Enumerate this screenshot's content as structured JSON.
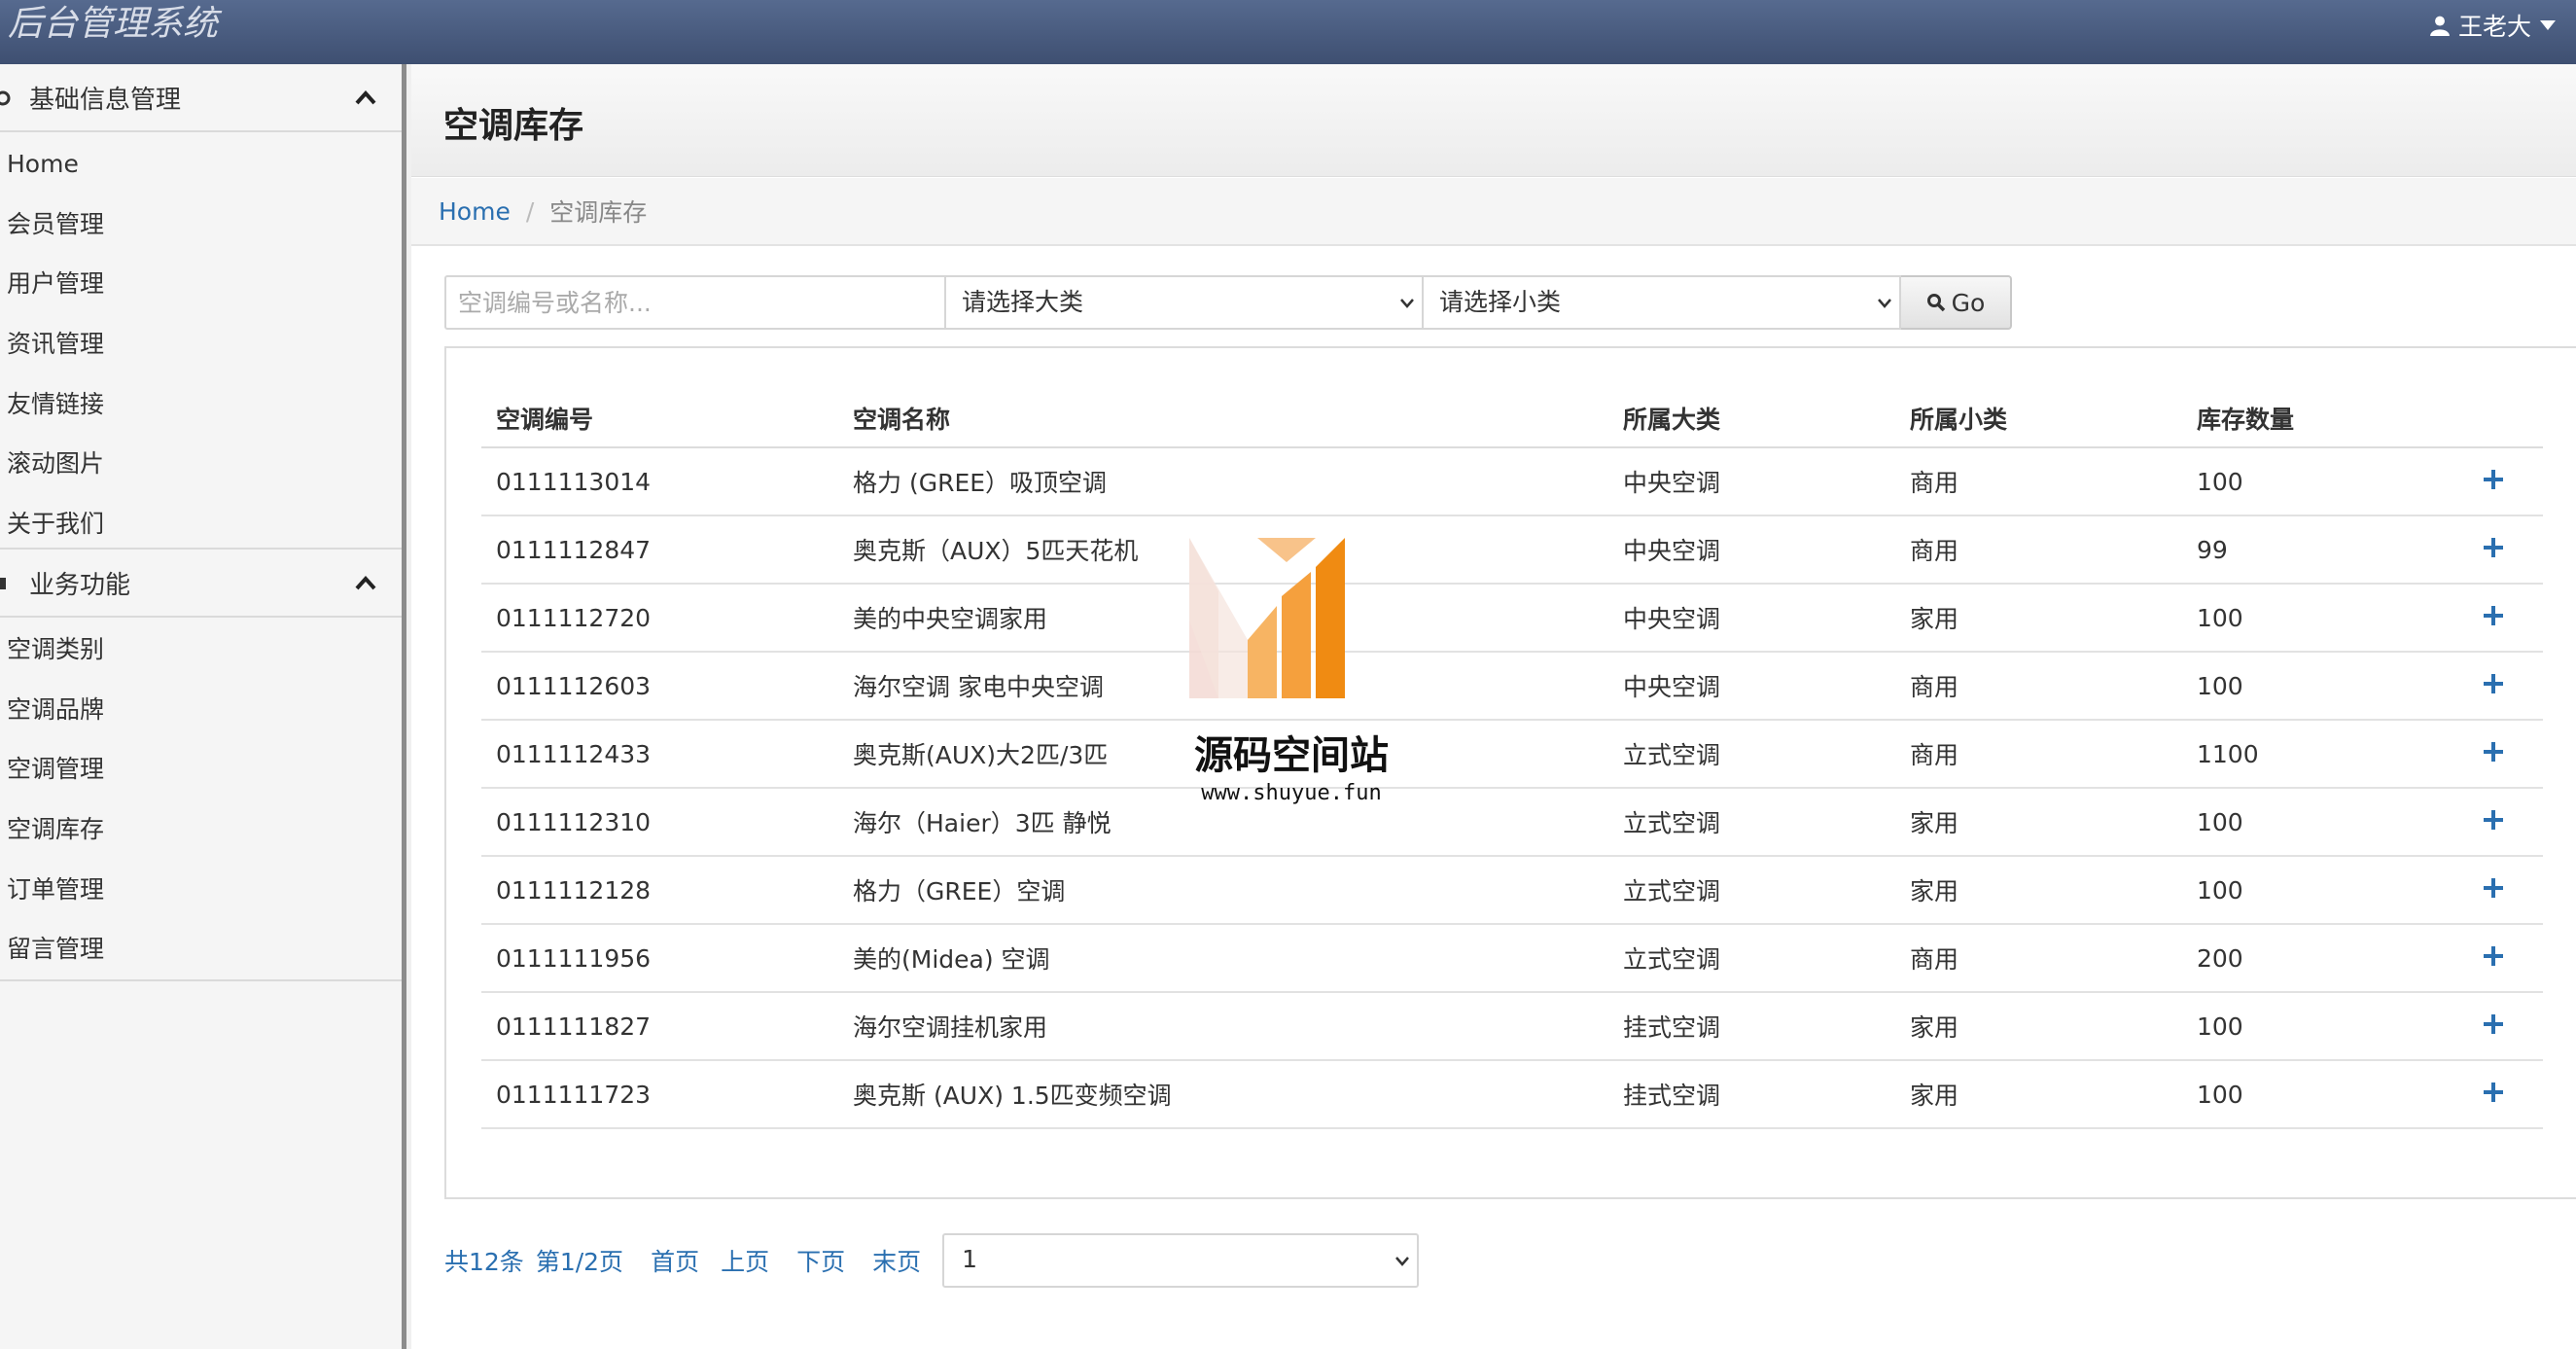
{
  "header": {
    "brand": "后台管理系统",
    "user_name": "王老大"
  },
  "sidebar": {
    "groups": [
      {
        "label": "基础信息管理",
        "items": [
          "Home",
          "会员管理",
          "用户管理",
          "资讯管理",
          "友情链接",
          "滚动图片",
          "关于我们"
        ]
      },
      {
        "label": "业务功能",
        "items": [
          "空调类别",
          "空调品牌",
          "空调管理",
          "空调库存",
          "订单管理",
          "留言管理"
        ]
      }
    ]
  },
  "page": {
    "title": "空调库存",
    "breadcrumb": {
      "home": "Home",
      "separator": "/",
      "current": "空调库存"
    }
  },
  "search": {
    "placeholder": "空调编号或名称...",
    "big_category": "请选择大类",
    "small_category": "请选择小类",
    "go_label": "Go"
  },
  "table": {
    "columns": [
      "空调编号",
      "空调名称",
      "所属大类",
      "所属小类",
      "库存数量"
    ],
    "rows": [
      [
        "0111113014",
        "格力 (GREE）吸顶空调",
        "中央空调",
        "商用",
        "100"
      ],
      [
        "0111112847",
        "奥克斯（AUX）5匹天花机",
        "中央空调",
        "商用",
        "99"
      ],
      [
        "0111112720",
        "美的中央空调家用",
        "中央空调",
        "家用",
        "100"
      ],
      [
        "0111112603",
        "海尔空调 家电中央空调",
        "中央空调",
        "商用",
        "100"
      ],
      [
        "0111112433",
        "奥克斯(AUX)大2匹/3匹",
        "立式空调",
        "商用",
        "1100"
      ],
      [
        "0111112310",
        "海尔（Haier）3匹 静悦",
        "立式空调",
        "家用",
        "100"
      ],
      [
        "0111112128",
        "格力（GREE）空调",
        "立式空调",
        "家用",
        "100"
      ],
      [
        "0111111956",
        "美的(Midea) 空调",
        "立式空调",
        "商用",
        "200"
      ],
      [
        "0111111827",
        "海尔空调挂机家用",
        "挂式空调",
        "家用",
        "100"
      ],
      [
        "0111111723",
        "奥克斯 (AUX) 1.5匹变频空调",
        "挂式空调",
        "家用",
        "100"
      ]
    ]
  },
  "pager": {
    "total": "共12条",
    "page_info": "第1/2页",
    "first": "首页",
    "prev": "上页",
    "next": "下页",
    "last": "末页",
    "selected_page": "1"
  },
  "watermark": {
    "name": "源码空间站",
    "url": "www.shuyue.fun"
  },
  "colors": {
    "topbar": "#4a5c80",
    "link": "#2a6fb0",
    "plus": "#2a6fb0",
    "sidebar_border": "#8c8c8c"
  }
}
